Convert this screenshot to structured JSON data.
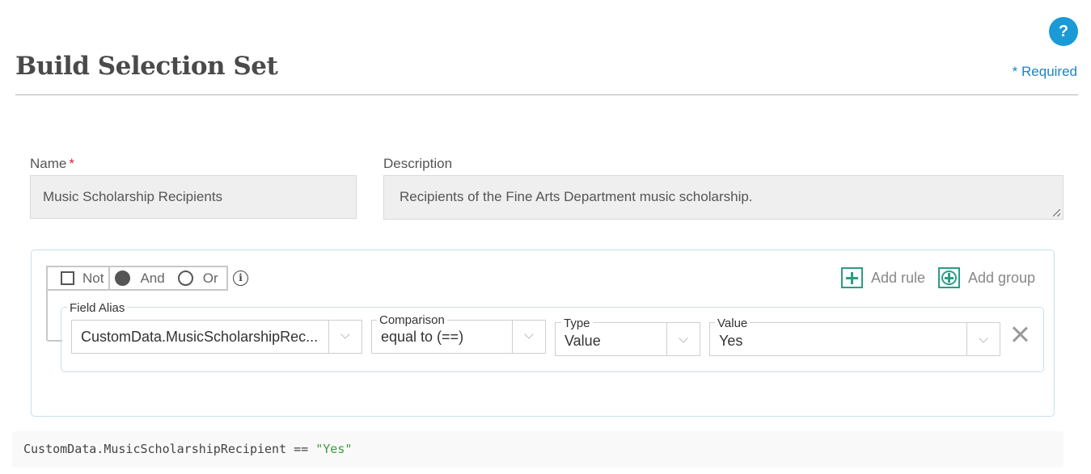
{
  "header": {
    "title": "Build Selection Set",
    "help_label": "?",
    "required_note": "* Required"
  },
  "form": {
    "name": {
      "label": "Name",
      "required_marker": "*",
      "value": "Music Scholarship Recipients"
    },
    "description": {
      "label": "Description",
      "value": "Recipients of the Fine Arts Department music scholarship."
    }
  },
  "query_builder": {
    "combinator": {
      "not_label": "Not",
      "not_checked": false,
      "and_label": "And",
      "or_label": "Or",
      "selected": "And"
    },
    "add_rule_label": "Add rule",
    "add_group_label": "Add group",
    "rules": [
      {
        "field_label": "Field Alias",
        "field_value": "CustomData.MusicScholarshipRec...",
        "comparison_label": "Comparison",
        "comparison_value": "equal to (==)",
        "type_label": "Type",
        "type_value": "Value",
        "value_label": "Value",
        "value_value": "Yes"
      }
    ]
  },
  "expression": {
    "lhs": "CustomData.MusicScholarshipRecipient == ",
    "rhs": "\"Yes\""
  },
  "colors": {
    "accent_blue": "#1a9ad6",
    "teal": "#2a9d86",
    "required_red": "#d0233a",
    "string_green": "#3d9a3d"
  }
}
